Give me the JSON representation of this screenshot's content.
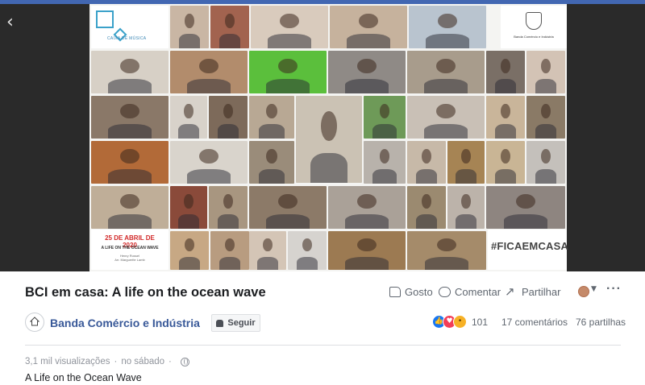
{
  "video": {
    "date_heading": "25 DE ABRIL DE 2020",
    "piece_title": "A LIFE ON THE OCEAN WAVE",
    "credit_line1": "Henry Russel",
    "credit_line2": "Arr. Marguerite Lamb",
    "hashtag": "#FICAEMCASA",
    "logo_caption": "CAIXA DE MÚSICA",
    "crest_caption": "Banda Comércio e Indústria",
    "tiles": [
      {
        "c": "#c9b6a4"
      },
      {
        "c": "#a2634f"
      },
      {
        "c": "#d9cbbd"
      },
      {
        "c": "#c6b29d"
      },
      {
        "c": "#b9c4cf"
      },
      {
        "c": "#d7d0c6"
      },
      {
        "c": "#b28c6c"
      },
      {
        "c": "#5bbf3c"
      },
      {
        "c": "#8f8a86"
      },
      {
        "c": "#a89c8c"
      },
      {
        "c": "#7a6f66"
      },
      {
        "c": "#d3c3b5"
      },
      {
        "c": "#8a7868"
      },
      {
        "c": "#d8d2ca"
      },
      {
        "c": "#7d6a5a"
      },
      {
        "c": "#b8a894"
      },
      {
        "c": "#cbc2b4"
      },
      {
        "c": "#6e9a58"
      },
      {
        "c": "#c9c0b6"
      },
      {
        "c": "#c9b59a"
      },
      {
        "c": "#8a7a66"
      },
      {
        "c": "#7f8f5d"
      },
      {
        "c": "#b26a38"
      },
      {
        "c": "#d9d4cc"
      },
      {
        "c": "#9a8c7a"
      },
      {
        "c": "#b8b2ab"
      },
      {
        "c": "#c7b9a8"
      },
      {
        "c": "#a68454"
      },
      {
        "c": "#c9b595"
      },
      {
        "c": "#c4c0bb"
      },
      {
        "c": "#8a4a3a"
      },
      {
        "c": "#a89680"
      },
      {
        "c": "#8c7a68"
      },
      {
        "c": "#aaa198"
      },
      {
        "c": "#9b8a70"
      },
      {
        "c": "#bcb3aa"
      },
      {
        "c": "#8e8580"
      },
      {
        "c": "#c7a884"
      },
      {
        "c": "#b89c80"
      },
      {
        "c": "#d4c5b6"
      },
      {
        "c": "#d6d3cf"
      },
      {
        "c": "#9c7a52"
      }
    ]
  },
  "post": {
    "title": "BCI em casa: A life on the ocean wave",
    "like_label": "Gosto",
    "comment_label": "Comentar",
    "share_label": "Partilhar",
    "page_name": "Banda Comércio e Indústria",
    "follow_label": "Seguir",
    "reaction_count": "101",
    "comments_count": "17 comentários",
    "shares_count": "76 partilhas",
    "views": "3,1 mil visualizações",
    "date": "no sábado",
    "description": "A Life on the Ocean Wave"
  },
  "colors": {
    "accent_blue": "#4267b2",
    "link_blue": "#385898",
    "date_red": "#d22a2a",
    "like_blue": "#1877f2",
    "love_red": "#f33e58",
    "wow_yellow": "#f7b125"
  },
  "icons": [
    "chevron-left-icon",
    "like-icon",
    "comment-icon",
    "share-icon",
    "chevron-down-icon",
    "more-icon",
    "bell-icon",
    "globe-icon"
  ]
}
